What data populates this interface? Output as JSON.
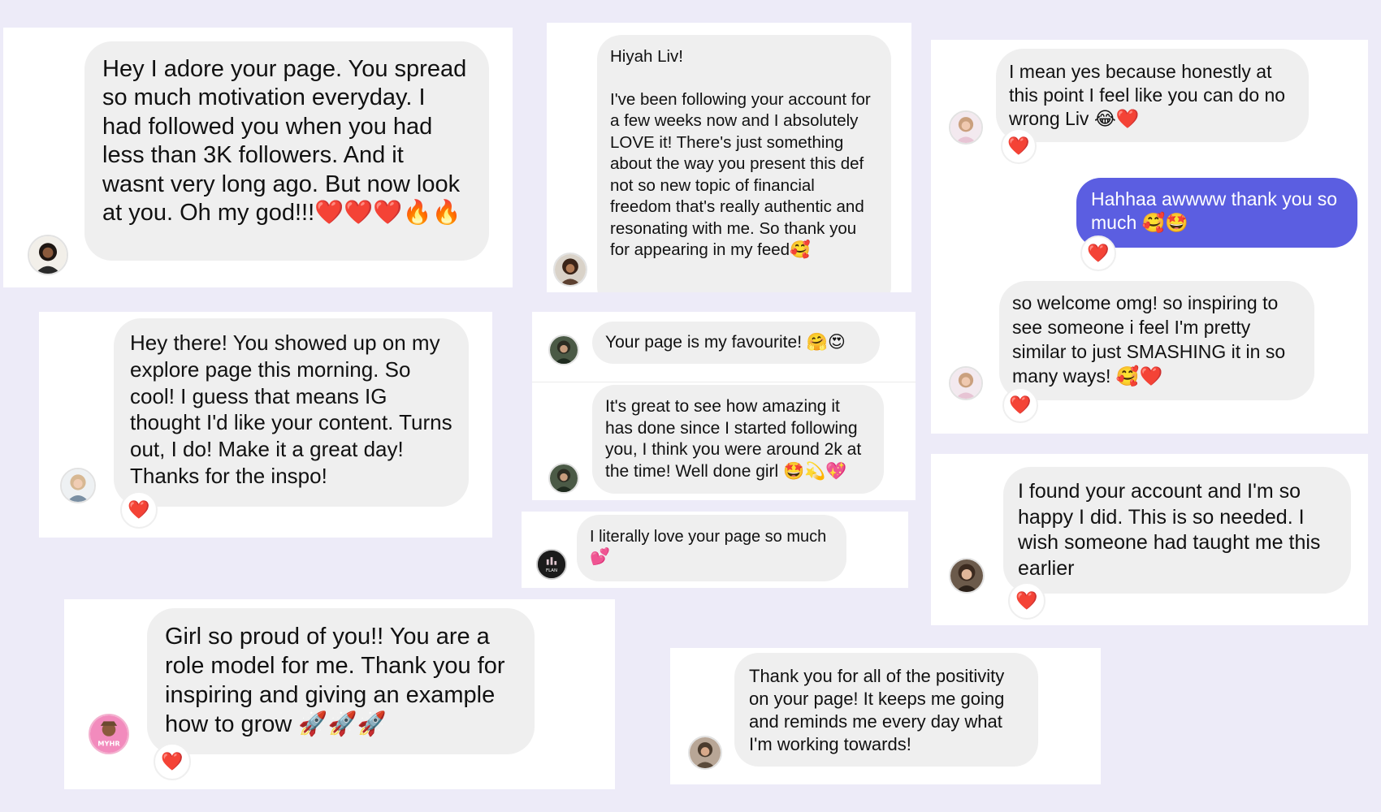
{
  "messages": [
    {
      "text": "Hey I adore your page. You spread so much motivation everyday. I had followed you when you had less than 3K followers. And it wasnt very long ago. But now look at you. Oh my god!!!❤️❤️❤️🔥🔥"
    },
    {
      "text": "Hiyah Liv!\n\nI've been following your account for a few weeks now and I absolutely LOVE it! There's just something about the way you present this def not so new topic of financial freedom that's really authentic and resonating with me. So thank you for appearing in my feed🥰"
    },
    {
      "text": "I mean yes because honestly at this point I feel like you can do no wrong Liv 😂❤️"
    },
    {
      "text": "Hahhaa awwww thank you so much 🥰🤩"
    },
    {
      "text": "so welcome omg! so inspiring to see someone i feel I'm pretty similar to just SMASHING it in so many ways! 🥰❤️"
    },
    {
      "text": "Hey there! You showed up on my explore page this morning. So cool! I guess that means IG thought I'd like your content. Turns out, I do! Make it a great day! Thanks for the inspo!"
    },
    {
      "text": "Your page is my favourite! 🤗😍"
    },
    {
      "text": "It's great to see how amazing it has done since I started following you, I think you were around 2k at the time! Well done girl 🤩💫💖"
    },
    {
      "text": "I literally love your page so much 💕"
    },
    {
      "text": "I found your account and I'm so happy I did. This is so needed. I wish someone had taught me this earlier"
    },
    {
      "text": "Girl so proud of you!! You are a role model for me. Thank you for inspiring and giving an example how to grow 🚀🚀🚀"
    },
    {
      "text": "Thank you for all of the positivity on your page! It keeps me going and reminds me every day what I'm working towards!"
    }
  ],
  "reaction_emoji": "❤️",
  "avatar_texts": {
    "planner": "FLAN",
    "myhr": "MYHR"
  },
  "colors": {
    "background": "#edebf8",
    "bubble_received": "#efefef",
    "bubble_sent": "#5b5ee1",
    "reaction_heart": "#e8112d"
  }
}
